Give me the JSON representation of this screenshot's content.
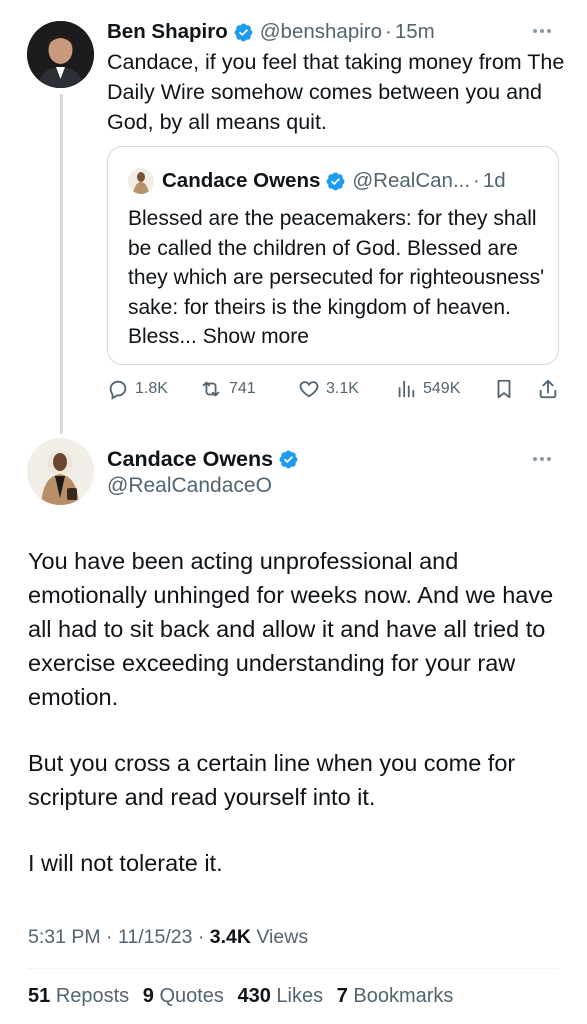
{
  "tweet1": {
    "author_name": "Ben Shapiro",
    "handle": "@benshapiro",
    "separator": "·",
    "time": "15m",
    "text": "Candace, if you feel that taking money from The Daily Wire somehow comes between you and God, by all means quit.",
    "more_icon": "more-dots-icon",
    "quoted": {
      "author_name": "Candace Owens",
      "handle": "@RealCan...",
      "separator": "·",
      "time": "1d",
      "text": "Blessed are the peacemakers: for they shall be called the children of God. Blessed are they which are persecuted for righteousness' sake: for theirs is the kingdom of heaven. Bless...",
      "show_more": "Show more"
    },
    "actions": {
      "replies": "1.8K",
      "reposts": "741",
      "likes": "3.1K",
      "views": "549K"
    }
  },
  "tweet2": {
    "author_name": "Candace Owens",
    "handle": "@RealCandaceO",
    "paragraphs": [
      "You have been acting unprofessional and emotionally unhinged  for weeks now. And we have all had to sit back and allow it and have all tried to exercise exceeding understanding for your raw emotion.",
      "But you cross a certain line when you come for scripture and read yourself into it.",
      "I will not tolerate it."
    ],
    "time": "5:31 PM",
    "date": "11/15/23",
    "separator": "·",
    "views_count": "3.4K",
    "views_label": "Views",
    "stats": {
      "reposts_count": "51",
      "reposts_label": "Reposts",
      "quotes_count": "9",
      "quotes_label": "Quotes",
      "likes_count": "430",
      "likes_label": "Likes",
      "bookmarks_count": "7",
      "bookmarks_label": "Bookmarks"
    }
  },
  "colors": {
    "verified_blue": "#1d9bf0",
    "text_primary": "#0f1419",
    "text_secondary": "#536471",
    "border": "#cfd9de"
  }
}
